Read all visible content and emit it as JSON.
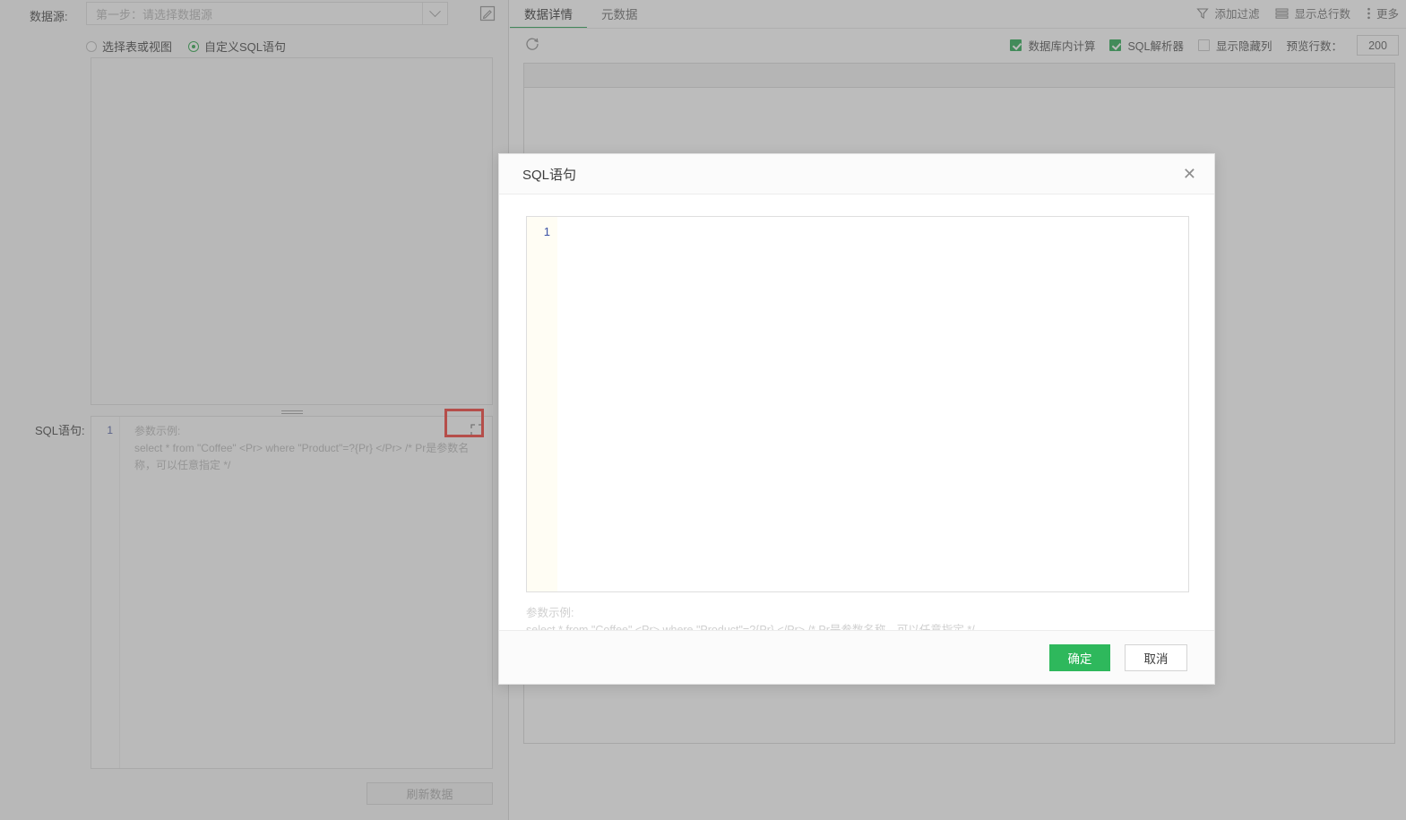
{
  "left": {
    "datasource_label": "数据源:",
    "datasource_placeholder": "第一步：请选择数据源",
    "datasource_value": "",
    "dropdown_icon": "chevron-down-icon",
    "edit_icon": "edit-pencil-icon",
    "radios": [
      {
        "label": "选择表或视图",
        "selected": false
      },
      {
        "label": "自定义SQL语句",
        "selected": true
      }
    ],
    "sql_label": "SQL语句:",
    "sql_line_number": "1",
    "sql_hint_line1": "参数示例:",
    "sql_hint_line2": "select * from \"Coffee\" <Pr> where \"Product\"=?{Pr} </Pr>  /* Pr是参数名称，可以任意指定 */",
    "expand_icon": "expand-fullscreen-icon",
    "refresh_data_button": "刷新数据"
  },
  "right": {
    "tabs": [
      {
        "label": "数据详情",
        "active": true
      },
      {
        "label": "元数据",
        "active": false
      }
    ],
    "header_actions": [
      {
        "label": "添加过滤",
        "icon": "filter-funnel-icon"
      },
      {
        "label": "显示总行数",
        "icon": "rows-list-icon"
      },
      {
        "label": "更多",
        "icon": "more-vertical-dots-icon"
      }
    ],
    "refresh_icon": "refresh-circular-icon",
    "options": [
      {
        "label": "数据库内计算",
        "checked": true
      },
      {
        "label": "SQL解析器",
        "checked": true
      },
      {
        "label": "显示隐藏列",
        "checked": false
      }
    ],
    "preview_rows_label": "预览行数：",
    "preview_rows_value": "200"
  },
  "modal": {
    "title": "SQL语句",
    "close_icon": "close-x-icon",
    "line_number": "1",
    "editor_value": "",
    "hint_line1": "参数示例:",
    "hint_line2": "select * from \"Coffee\" <Pr> where \"Product\"=?{Pr} </Pr>  /* Pr是参数名称，可以任意指定 */",
    "confirm_label": "确定",
    "cancel_label": "取消"
  },
  "colors": {
    "accent_green": "#1e9e4a",
    "primary_button": "#2eb85c",
    "highlight_red": "#f2352e",
    "line_number_blue": "#3c52a5"
  }
}
